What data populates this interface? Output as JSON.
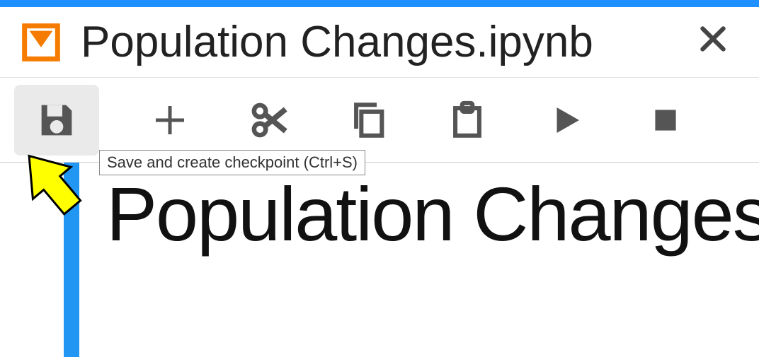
{
  "tab": {
    "title": "Population Changes.ipynb",
    "icon": "notebook-icon"
  },
  "toolbar": {
    "save_tooltip": "Save and create checkpoint (Ctrl+S)"
  },
  "content": {
    "heading": "Population Changes"
  }
}
